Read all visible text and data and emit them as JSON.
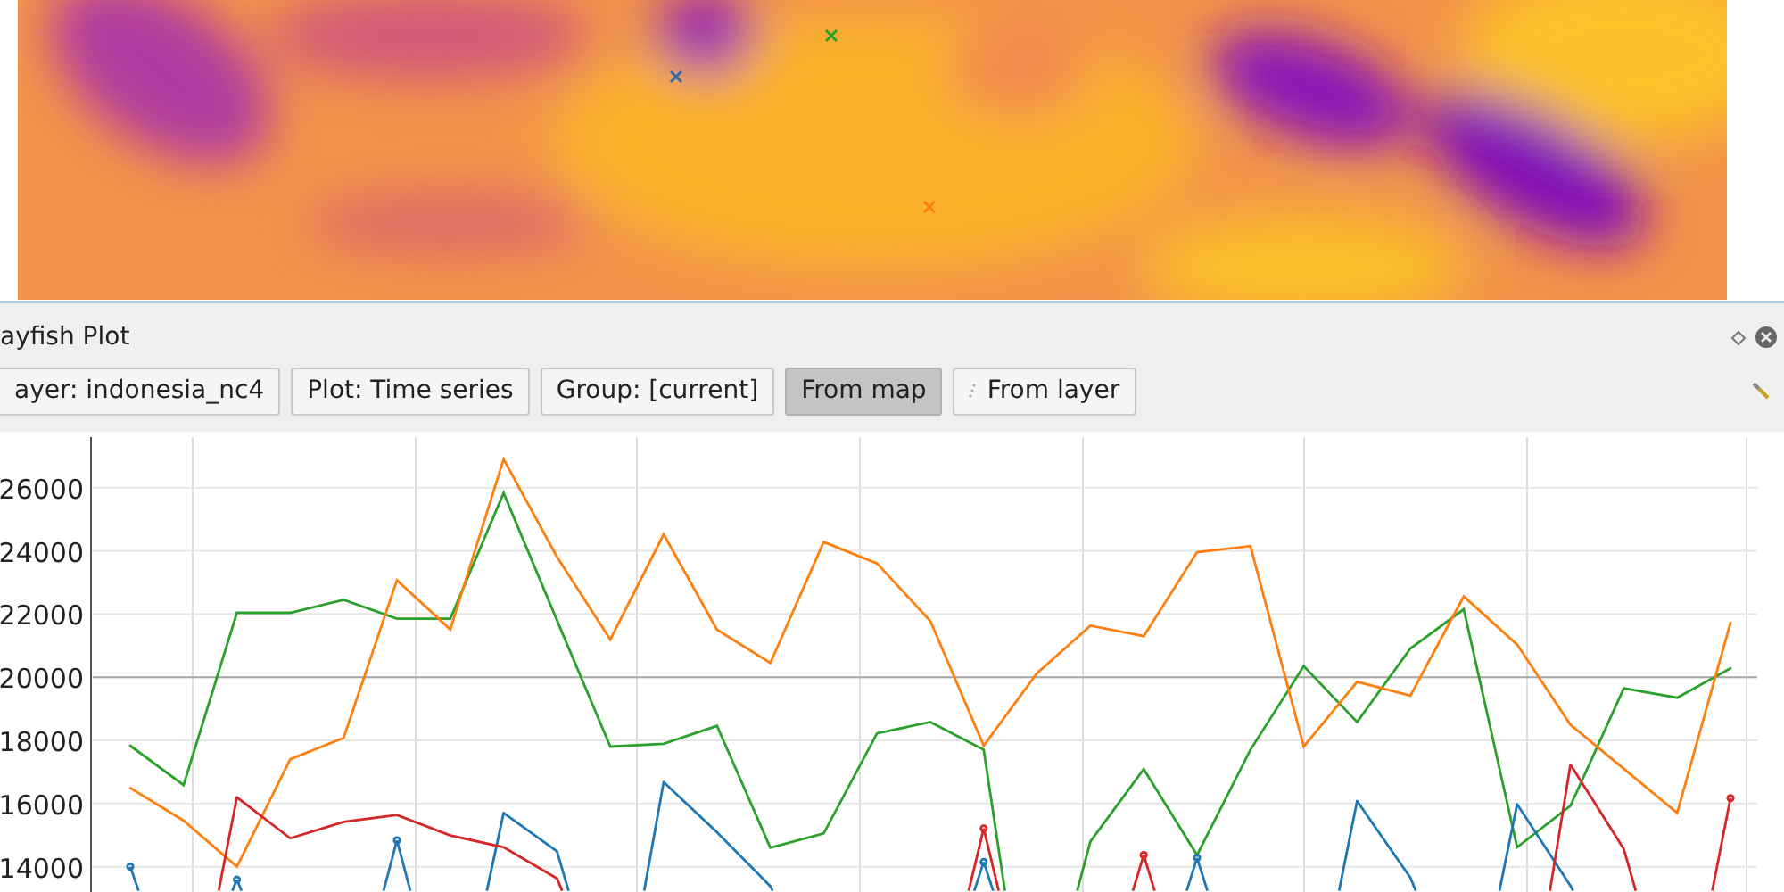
{
  "panel": {
    "title": "ayfish Plot"
  },
  "toolbar": [
    {
      "label": "ayer: indonesia_nc4",
      "selected": false,
      "kind": "text"
    },
    {
      "label": "Plot: Time series",
      "selected": false,
      "kind": "text"
    },
    {
      "label": "Group: [current]",
      "selected": false,
      "kind": "text"
    },
    {
      "label": "From map",
      "selected": true,
      "kind": "text"
    },
    {
      "label": "From layer",
      "selected": false,
      "kind": "icon"
    }
  ],
  "chart": {
    "chart_data": {
      "type": "line",
      "grid": true,
      "ylim": [
        13200,
        27600
      ],
      "yticks": [
        14000,
        16000,
        18000,
        20000,
        22000,
        24000,
        26000
      ],
      "ref_lines": [
        {
          "axis": "y",
          "value": 20000
        }
      ],
      "series": [
        {
          "color": "#2ca02c",
          "values": [
            17830,
            16580,
            22040,
            22040,
            22450,
            21850,
            21850,
            25830,
            21800,
            17800,
            17890,
            18460,
            14600,
            15050,
            18220,
            18580,
            17700,
            null,
            14800,
            17090,
            14370,
            17700,
            20350,
            18580,
            20910,
            22150,
            14620,
            15930,
            19650,
            19350,
            20280
          ]
        },
        {
          "color": "#ff7f0e",
          "values": [
            16490,
            15460,
            14000,
            17400,
            18080,
            23070,
            21510,
            26900,
            23810,
            21190,
            24520,
            21500,
            20450,
            24280,
            23600,
            21780,
            17830,
            20130,
            21630,
            21300,
            23960,
            24150,
            17800,
            19850,
            19420,
            22560,
            21030,
            18490,
            17100,
            15700,
            21720
          ]
        },
        {
          "color": "#1f77b4",
          "values": [
            14000,
            null,
            13590,
            null,
            null,
            14840,
            null,
            15700,
            14490,
            null,
            16680,
            15090,
            13380,
            null,
            null,
            null,
            14150,
            null,
            null,
            null,
            14280,
            null,
            null,
            16080,
            13650,
            null,
            15980,
            13400,
            null,
            null,
            null
          ]
        },
        {
          "color": "#d62728",
          "values": [
            null,
            null,
            16200,
            14900,
            15420,
            15640,
            14990,
            14620,
            13630,
            null,
            null,
            null,
            null,
            null,
            null,
            null,
            15210,
            null,
            null,
            14370,
            null,
            null,
            null,
            null,
            null,
            null,
            null,
            17230,
            14560,
            null,
            16170
          ]
        }
      ]
    }
  }
}
